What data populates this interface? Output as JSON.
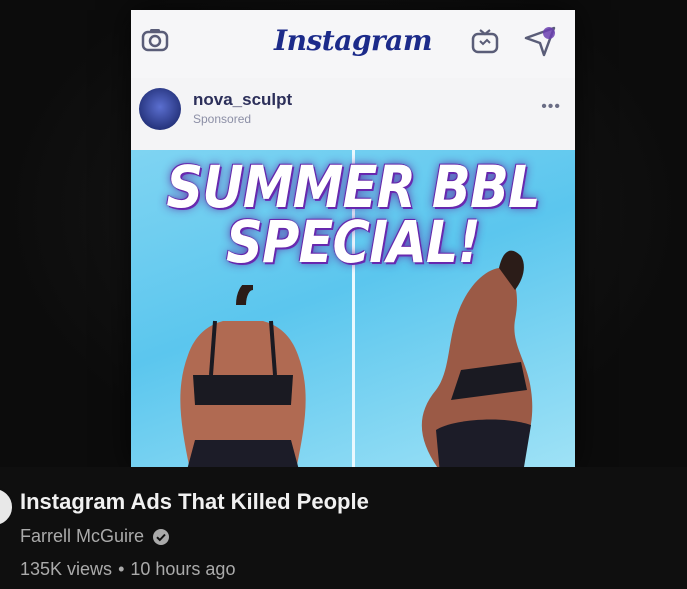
{
  "thumbnail": {
    "app_logo": "Instagram",
    "account": "nova_sculpt",
    "sponsored_label": "Sponsored",
    "more_label": "•••",
    "headline_line1": "SUMMER BBL",
    "headline_line2": "SPECIAL!",
    "icons": [
      "camera-icon",
      "igtv-icon",
      "send-icon"
    ],
    "colors": {
      "ad_background": "#5bc6ee",
      "headline_outline": "#6a2bb3",
      "logo": "#1c2b8a"
    }
  },
  "video": {
    "title": "Instagram Ads That Killed People",
    "channel": "Farrell McGuire",
    "views": "135K views",
    "separator": "•",
    "age": "10 hours ago"
  }
}
